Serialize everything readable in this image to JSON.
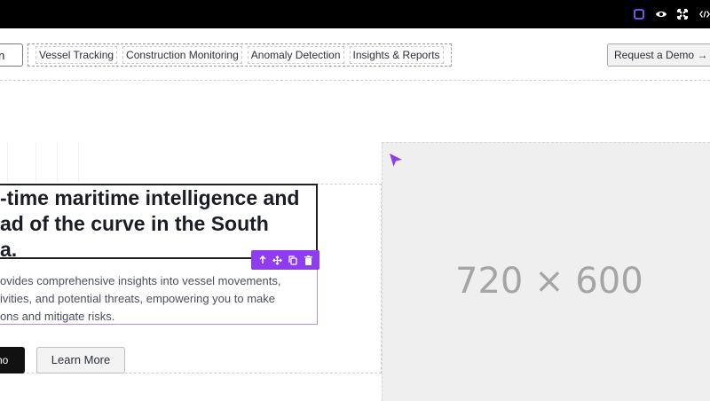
{
  "toolbar_icons": [
    "square-icon",
    "eye-icon",
    "fullscreen-icon",
    "code-icon"
  ],
  "header": {
    "brand_partial": "ian",
    "nav": [
      "Vessel Tracking",
      "Construction Monitoring",
      "Anomaly Detection",
      "Insights & Reports"
    ],
    "cta": "Request a Demo →"
  },
  "hero": {
    "headline_lines": [
      "-time maritime intelligence and",
      "ad of the curve in the South",
      "a."
    ],
    "paragraph_lines": [
      "ovides comprehensive insights into vessel movements,",
      "ivities, and potential threats, empowering you to make",
      "ons and mitigate risks."
    ],
    "primary_button_partial": "no",
    "secondary_button": "Learn More"
  },
  "element_toolbar": [
    "arrow-up-icon",
    "move-icon",
    "duplicate-icon",
    "trash-icon"
  ],
  "image_placeholder": {
    "label": "720 × 600"
  },
  "colors": {
    "accent": "#8f3cf0",
    "placeholder_bg": "#efefef"
  }
}
